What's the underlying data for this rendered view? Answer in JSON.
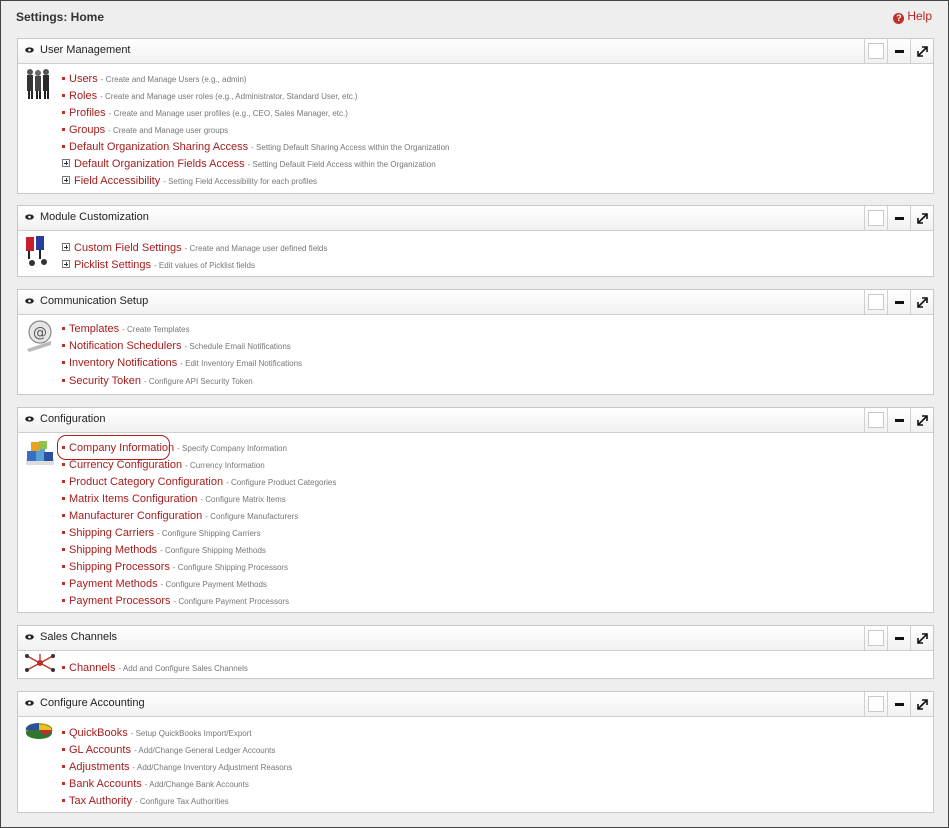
{
  "page": {
    "title": "Settings: Home",
    "help_label": "Help"
  },
  "sections": [
    {
      "title": "User Management",
      "icon": "users-icon",
      "items": [
        {
          "label": "Users",
          "desc": "- Create and Manage Users (e.g., admin)",
          "marker": "bullet"
        },
        {
          "label": "Roles",
          "desc": "- Create and Manage user roles (e.g., Administrator, Standard User, etc.)",
          "marker": "bullet"
        },
        {
          "label": "Profiles",
          "desc": "- Create and Manage user profiles (e.g., CEO, Sales Manager, etc.)",
          "marker": "bullet"
        },
        {
          "label": "Groups",
          "desc": "- Create and Manage user groups",
          "marker": "bullet"
        },
        {
          "label": "Default Organization Sharing Access",
          "desc": "- Setting Default Sharing Access within the Organization",
          "marker": "bullet"
        },
        {
          "label": "Default Organization Fields Access",
          "desc": "- Setting Default Field Access within the Organization",
          "marker": "plus"
        },
        {
          "label": "Field Accessibility",
          "desc": "- Setting Field Accessibility for each profiles",
          "marker": "plus"
        }
      ]
    },
    {
      "title": "Module Customization",
      "icon": "module-customization-icon",
      "items": [
        {
          "label": "Custom Field Settings",
          "desc": "- Create and Manage user defined fields",
          "marker": "plus"
        },
        {
          "label": "Picklist Settings",
          "desc": "- Edit values of Picklist fields",
          "marker": "plus"
        }
      ]
    },
    {
      "title": "Communication Setup",
      "icon": "communication-icon",
      "items": [
        {
          "label": "Templates",
          "desc": "- Create Templates",
          "marker": "bullet"
        },
        {
          "label": "Notification Schedulers",
          "desc": "- Schedule Email Notifications",
          "marker": "bullet"
        },
        {
          "label": "Inventory Notifications",
          "desc": "- Edit Inventory Email Notifications",
          "marker": "bullet"
        },
        {
          "label": "Security Token",
          "desc": "- Configure API Security Token",
          "marker": "bullet"
        }
      ]
    },
    {
      "title": "Configuration",
      "icon": "configuration-icon",
      "items": [
        {
          "label": "Company Information",
          "desc": "- Specify Company Information",
          "marker": "bullet"
        },
        {
          "label": "Currency Configuration",
          "desc": "- Currency Information",
          "marker": "bullet"
        },
        {
          "label": "Product Category Configuration",
          "desc": "- Configure Product Categories",
          "marker": "bullet"
        },
        {
          "label": "Matrix Items Configuration",
          "desc": "- Configure Matrix Items",
          "marker": "bullet"
        },
        {
          "label": "Manufacturer Configuration",
          "desc": "- Configure Manufacturers",
          "marker": "bullet"
        },
        {
          "label": "Shipping Carriers",
          "desc": "- Configure Shipping Carriers",
          "marker": "bullet"
        },
        {
          "label": "Shipping Methods",
          "desc": "- Configure Shipping Methods",
          "marker": "bullet"
        },
        {
          "label": "Shipping Processors",
          "desc": "- Configure Shipping Processors",
          "marker": "bullet"
        },
        {
          "label": "Payment Methods",
          "desc": "- Configure Payment Methods",
          "marker": "bullet"
        },
        {
          "label": "Payment Processors",
          "desc": "- Configure Payment Processors",
          "marker": "bullet"
        }
      ]
    },
    {
      "title": "Sales Channels",
      "icon": "sales-channels-icon",
      "items": [
        {
          "label": "Channels",
          "desc": "- Add and Configure Sales Channels",
          "marker": "bullet"
        }
      ]
    },
    {
      "title": "Configure Accounting",
      "icon": "accounting-icon",
      "items": [
        {
          "label": "QuickBooks",
          "desc": "- Setup QuickBooks Import/Export",
          "marker": "bullet"
        },
        {
          "label": "GL Accounts",
          "desc": "- Add/Change General Ledger Accounts",
          "marker": "bullet"
        },
        {
          "label": "Adjustments",
          "desc": "- Add/Change Inventory Adjustment Reasons",
          "marker": "bullet"
        },
        {
          "label": "Bank Accounts",
          "desc": "- Add/Change Bank Accounts",
          "marker": "bullet"
        },
        {
          "label": "Tax Authority",
          "desc": "- Configure Tax Authorities",
          "marker": "bullet"
        }
      ]
    }
  ],
  "colors": {
    "link": "#a61d1d",
    "highlight_ring": "#b41d1d",
    "description": "#777777"
  }
}
